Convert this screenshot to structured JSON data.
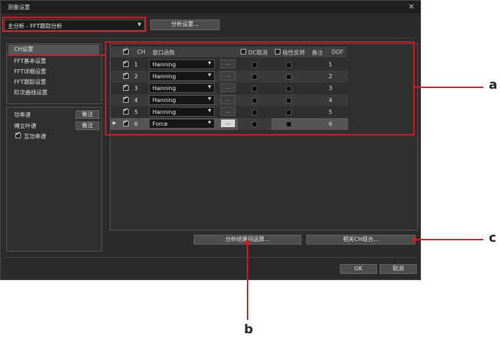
{
  "window": {
    "title": "测量设置",
    "close_icon": "close-icon"
  },
  "mode_select": {
    "value": "主分析 - FFT跟踪分析"
  },
  "analysis_settings_button": "分析设置...",
  "left_nav": {
    "items": [
      {
        "label": "CH设置",
        "selected": true
      },
      {
        "label": "FFT基本设置",
        "selected": false
      },
      {
        "label": "FFT详细设置",
        "selected": false
      },
      {
        "label": "FFT跟踪设置",
        "selected": false
      },
      {
        "label": "阶次曲线设置",
        "selected": false
      }
    ]
  },
  "functions": [
    {
      "label": "功率谱",
      "button": "备注",
      "checked": false
    },
    {
      "label": "傅立叶谱",
      "button": "备注",
      "checked": false
    },
    {
      "label": "互功率谱",
      "button": "",
      "checked": true
    }
  ],
  "table": {
    "headers": {
      "ch": "CH",
      "window_fn": "窗口函数",
      "dc_cancel": "DC取消",
      "polarity": "极性反转",
      "note": "备注",
      "dof": "DOF"
    },
    "rows": [
      {
        "ch": "1",
        "window": "Hanning",
        "dof": "1",
        "current": false
      },
      {
        "ch": "2",
        "window": "Hanning",
        "dof": "2",
        "current": false
      },
      {
        "ch": "3",
        "window": "Hanning",
        "dof": "3",
        "current": false
      },
      {
        "ch": "4",
        "window": "Hanning",
        "dof": "4",
        "current": false
      },
      {
        "ch": "5",
        "window": "Hanning",
        "dof": "5",
        "current": false
      },
      {
        "ch": "6",
        "window": "Force",
        "dof": "6",
        "current": true
      }
    ],
    "dots_label": "..."
  },
  "bottom_buttons": {
    "result_calc": "分析结果间运算...",
    "ch_combo": "相关CH组合..."
  },
  "dialog_buttons": {
    "ok": "OK",
    "cancel": "取消"
  },
  "callouts": {
    "a": "a",
    "b": "b",
    "c": "c"
  },
  "colors": {
    "highlight": "#d9191f",
    "background": "#2b2b2b"
  }
}
